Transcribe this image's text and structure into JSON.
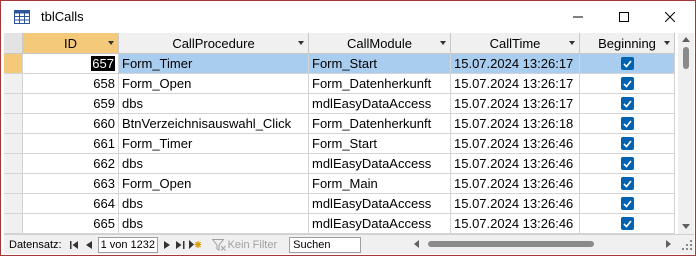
{
  "window": {
    "title": "tblCalls",
    "minimize_icon": "minimize-icon",
    "maximize_icon": "maximize-icon",
    "close_icon": "close-icon",
    "border_color": "#a4373a"
  },
  "columns": [
    {
      "label": "ID"
    },
    {
      "label": "CallProcedure"
    },
    {
      "label": "CallModule"
    },
    {
      "label": "CallTime"
    },
    {
      "label": "Beginning"
    }
  ],
  "rows": [
    {
      "id": "657",
      "procedure": "Form_Timer",
      "module": "Form_Start",
      "time": "15.07.2024 13:26:17",
      "beginning": true
    },
    {
      "id": "658",
      "procedure": "Form_Open",
      "module": "Form_Datenherkunft",
      "time": "15.07.2024 13:26:17",
      "beginning": true
    },
    {
      "id": "659",
      "procedure": "dbs",
      "module": "mdlEasyDataAccess",
      "time": "15.07.2024 13:26:17",
      "beginning": true
    },
    {
      "id": "660",
      "procedure": "BtnVerzeichnisauswahl_Click",
      "module": "Form_Datenherkunft",
      "time": "15.07.2024 13:26:18",
      "beginning": true
    },
    {
      "id": "661",
      "procedure": "Form_Timer",
      "module": "Form_Start",
      "time": "15.07.2024 13:26:46",
      "beginning": true
    },
    {
      "id": "662",
      "procedure": "dbs",
      "module": "mdlEasyDataAccess",
      "time": "15.07.2024 13:26:46",
      "beginning": true
    },
    {
      "id": "663",
      "procedure": "Form_Open",
      "module": "Form_Main",
      "time": "15.07.2024 13:26:46",
      "beginning": true
    },
    {
      "id": "664",
      "procedure": "dbs",
      "module": "mdlEasyDataAccess",
      "time": "15.07.2024 13:26:46",
      "beginning": true
    },
    {
      "id": "665",
      "procedure": "dbs",
      "module": "mdlEasyDataAccess",
      "time": "15.07.2024 13:26:46",
      "beginning": true
    }
  ],
  "current_row_index": 0,
  "colors": {
    "selected_row": "#a9cdee",
    "sorted_header": "#f5c97a",
    "checkbox": "#0063b1"
  },
  "navigation": {
    "label": "Datensatz:",
    "record_position": "1 von 1232",
    "filter_label": "Kein Filter",
    "search_placeholder": "Suchen"
  }
}
